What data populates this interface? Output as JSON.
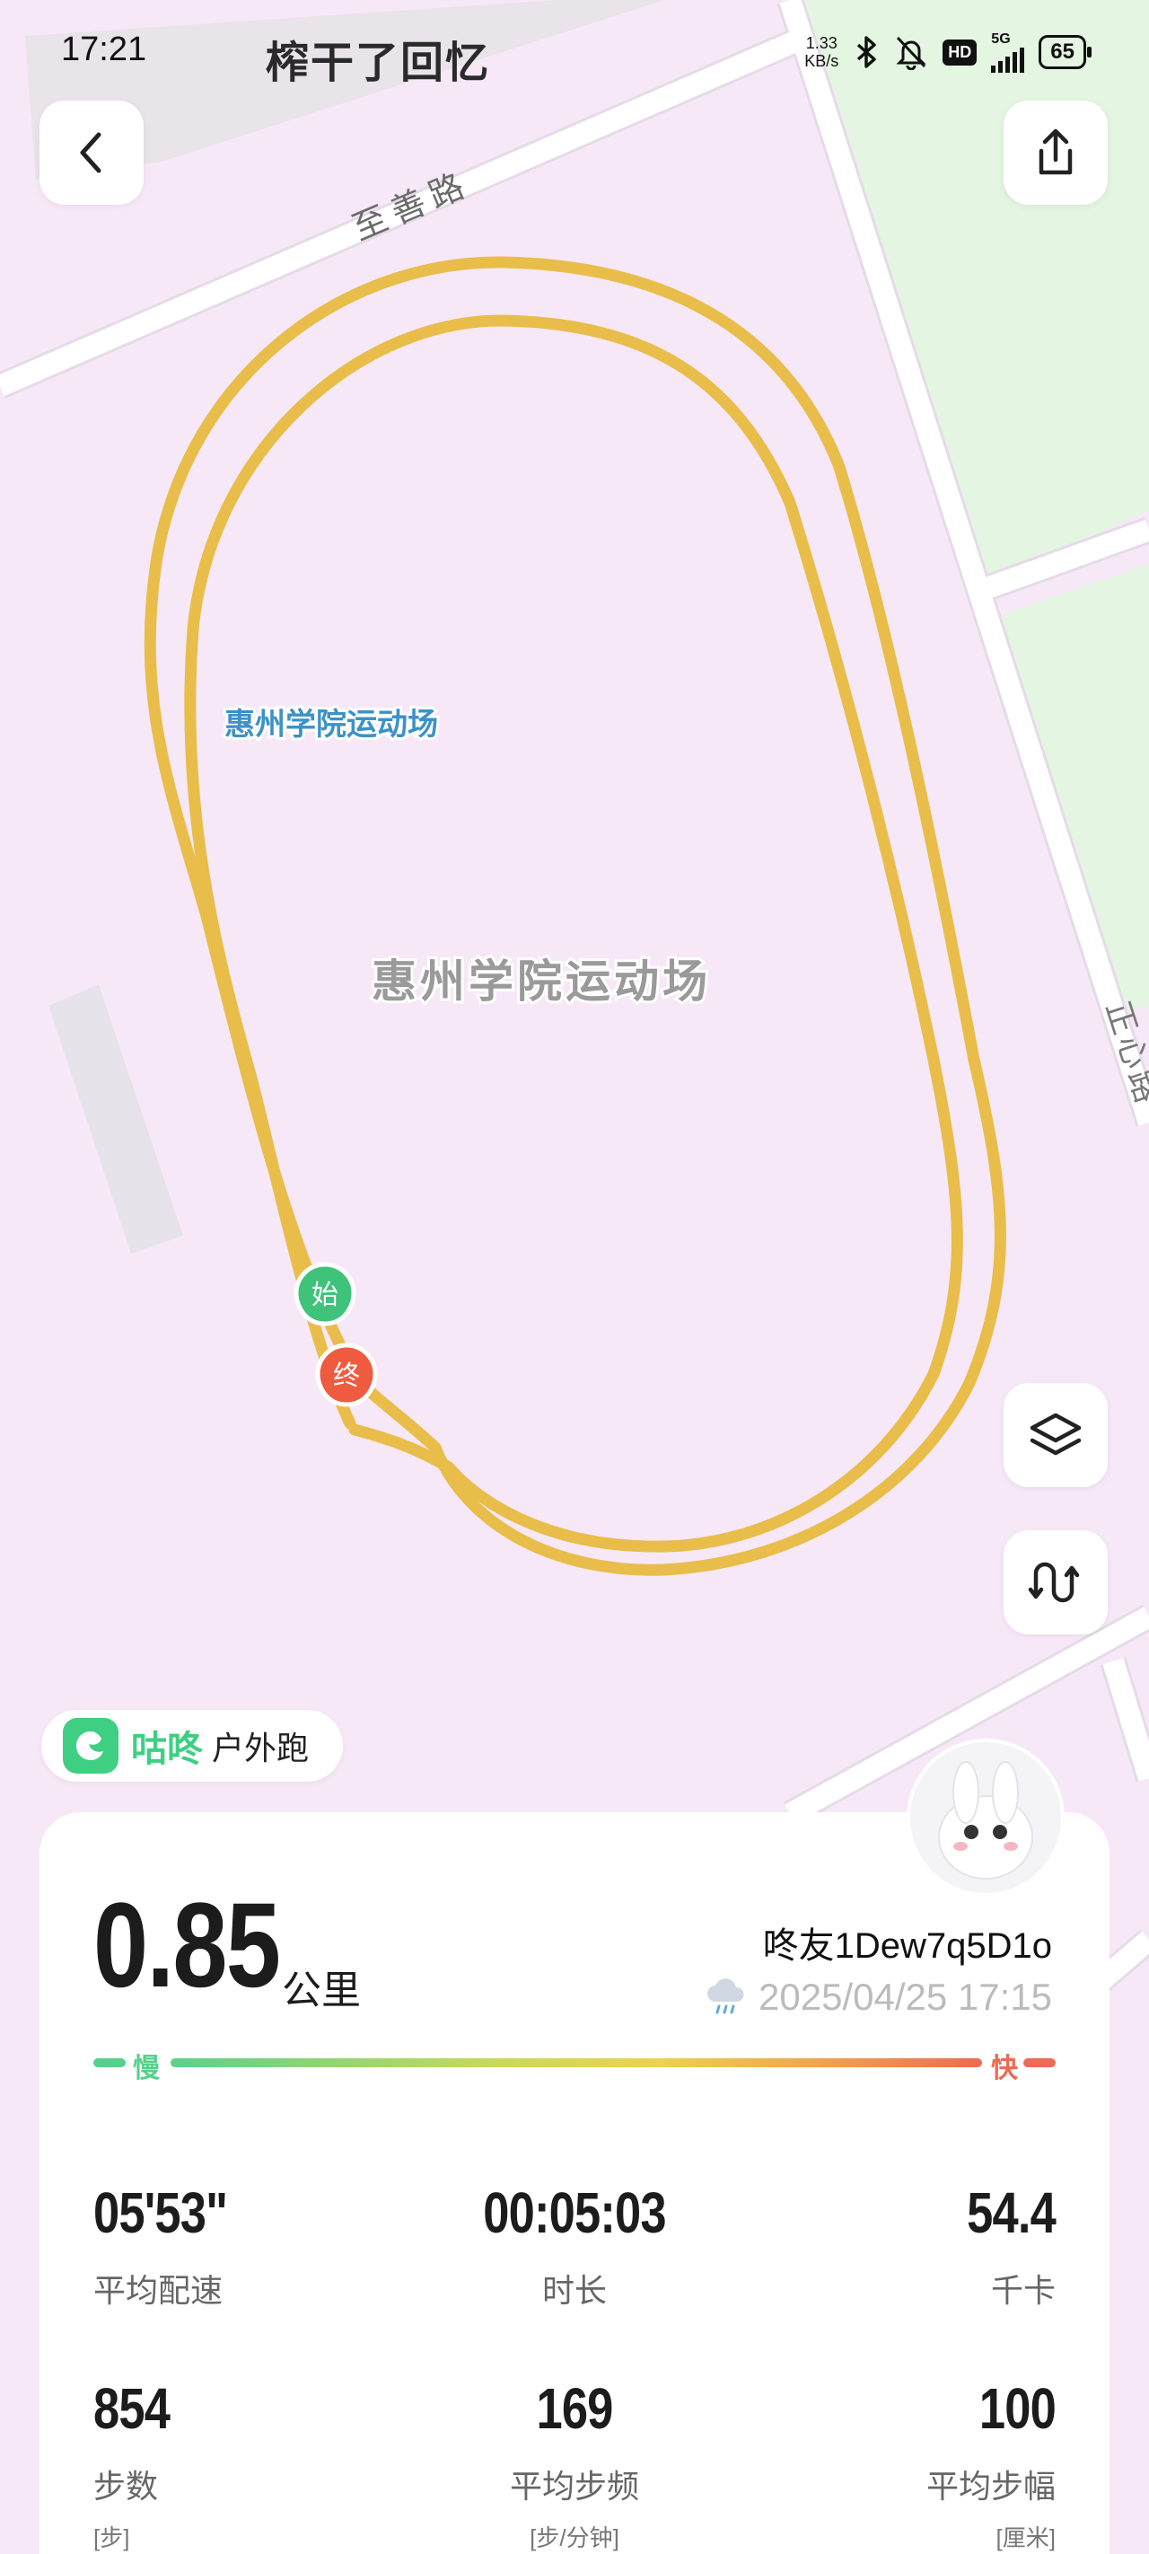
{
  "status_bar": {
    "time": "17:21",
    "app_title": "榨干了回忆",
    "net_speed_value": "1.33",
    "net_speed_unit": "KB/s",
    "hd_badge": "HD",
    "signal_type": "5G",
    "battery": "65"
  },
  "map": {
    "road_top": "至善路",
    "road_right": "正心路",
    "poi_blue_label": "惠州学院运动场",
    "poi_center_label": "惠州学院运动场",
    "start_marker": "始",
    "end_marker": "终",
    "route_color": "#e8bd4a"
  },
  "brand": {
    "name": "咕咚",
    "mode": "户外跑"
  },
  "summary": {
    "distance_value": "0.85",
    "distance_unit": "公里",
    "username": "咚友1Dew7q5D1o",
    "datetime": "2025/04/25 17:15",
    "weather_icon": "rain-cloud-icon"
  },
  "pace_bar": {
    "slow_label": "慢",
    "fast_label": "快"
  },
  "stats_row1": [
    {
      "value": "05'53\"",
      "label": "平均配速"
    },
    {
      "value": "00:05:03",
      "label": "时长"
    },
    {
      "value": "54.4",
      "label": "千卡"
    }
  ],
  "stats_row2": [
    {
      "value": "854",
      "label": "步数",
      "unit": "[步]"
    },
    {
      "value": "169",
      "label": "平均步频",
      "unit": "[步/分钟]"
    },
    {
      "value": "100",
      "label": "平均步幅",
      "unit": "[厘米]"
    }
  ],
  "colors": {
    "background": "#f7e8f7",
    "accent_green": "#3fcf83",
    "fast_red": "#ee6a53"
  }
}
